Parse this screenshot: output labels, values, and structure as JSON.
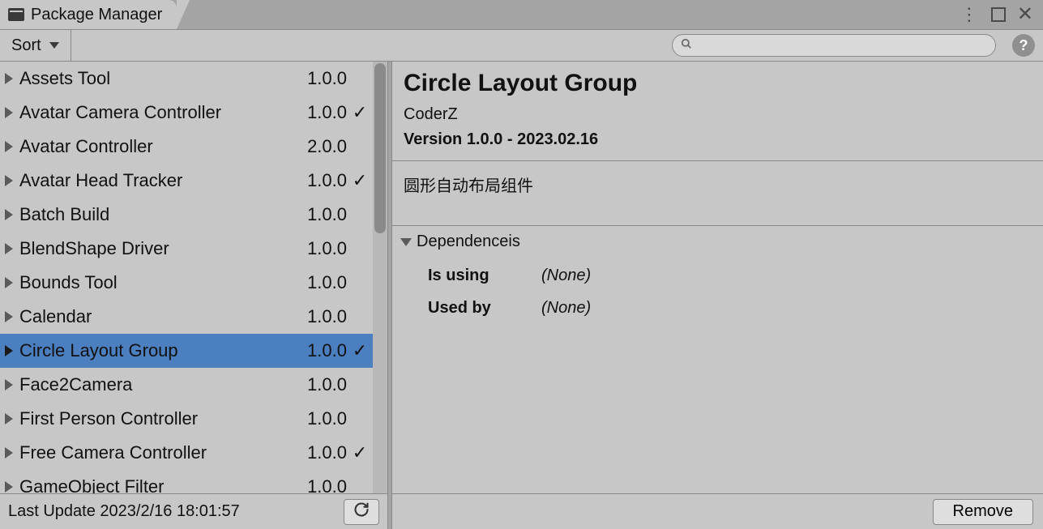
{
  "window": {
    "tab_title": "Package Manager"
  },
  "toolbar": {
    "sort_label": "Sort",
    "search_value": "",
    "search_placeholder": "",
    "help_label": "?"
  },
  "packages": [
    {
      "name": "Assets Tool",
      "version": "1.0.0",
      "installed": false,
      "selected": false
    },
    {
      "name": "Avatar Camera Controller",
      "version": "1.0.0",
      "installed": true,
      "selected": false
    },
    {
      "name": "Avatar Controller",
      "version": "2.0.0",
      "installed": false,
      "selected": false
    },
    {
      "name": "Avatar Head Tracker",
      "version": "1.0.0",
      "installed": true,
      "selected": false
    },
    {
      "name": "Batch Build",
      "version": "1.0.0",
      "installed": false,
      "selected": false
    },
    {
      "name": "BlendShape Driver",
      "version": "1.0.0",
      "installed": false,
      "selected": false
    },
    {
      "name": "Bounds Tool",
      "version": "1.0.0",
      "installed": false,
      "selected": false
    },
    {
      "name": "Calendar",
      "version": "1.0.0",
      "installed": false,
      "selected": false
    },
    {
      "name": "Circle Layout Group",
      "version": "1.0.0",
      "installed": true,
      "selected": true
    },
    {
      "name": "Face2Camera",
      "version": "1.0.0",
      "installed": false,
      "selected": false
    },
    {
      "name": "First Person Controller",
      "version": "1.0.0",
      "installed": false,
      "selected": false
    },
    {
      "name": "Free Camera Controller",
      "version": "1.0.0",
      "installed": true,
      "selected": false
    },
    {
      "name": "GameObject Filter",
      "version": "1.0.0",
      "installed": false,
      "selected": false
    }
  ],
  "footer": {
    "last_update": "Last Update 2023/2/16 18:01:57"
  },
  "detail": {
    "title": "Circle Layout Group",
    "author": "CoderZ",
    "version_line": "Version 1.0.0 - 2023.02.16",
    "description": "圆形自动布局组件",
    "deps_header": "Dependenceis",
    "is_using_label": "Is using",
    "is_using_value": "(None)",
    "used_by_label": "Used by",
    "used_by_value": "(None)",
    "remove_label": "Remove"
  }
}
